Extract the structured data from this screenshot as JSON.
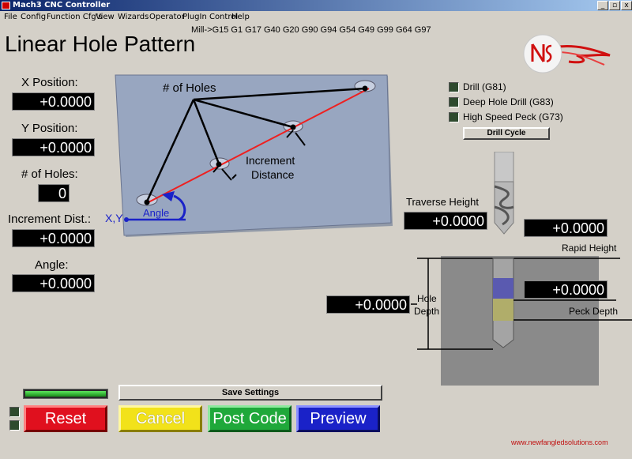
{
  "window": {
    "title": "Mach3 CNC Controller",
    "minimize": "_",
    "restore": "▫",
    "close": "x"
  },
  "menu": [
    "File",
    "Config",
    "Function Cfg's",
    "View",
    "Wizards",
    "Operator",
    "PlugIn Control",
    "Help"
  ],
  "gcode_line": "Mill->G15  G1 G17 G40 G20 G90 G94 G54 G49 G99 G64 G97",
  "page_title": "Linear Hole Pattern",
  "fields": {
    "x_position": {
      "label": "X Position:",
      "value": "+0.0000"
    },
    "y_position": {
      "label": "Y Position:",
      "value": "+0.0000"
    },
    "num_holes": {
      "label": "# of Holes:",
      "value": "0"
    },
    "increment": {
      "label": "Increment Dist.:",
      "value": "+0.0000"
    },
    "angle": {
      "label": "Angle:",
      "value": "+0.0000"
    }
  },
  "diagram": {
    "holes_label": "# of Holes",
    "increment_label_1": "Increment",
    "increment_label_2": "Distance",
    "angle_label": "Angle",
    "xy_label": "X,Y"
  },
  "cycles": {
    "drill": "Drill (G81)",
    "deep_drill": "Deep Hole Drill (G83)",
    "peck": "High Speed Peck (G73)",
    "button": "Drill Cycle"
  },
  "heights": {
    "traverse_label": "Traverse Height",
    "traverse_value": "+0.0000",
    "rapid_label": "Rapid Height",
    "rapid_value": "+0.0000",
    "hole_depth_label_1": "Hole",
    "hole_depth_label_2": "Depth",
    "hole_depth_value": "+0.0000",
    "peck_label": "Peck Depth",
    "peck_value": "+0.0000"
  },
  "buttons": {
    "save": "Save Settings",
    "reset": "Reset",
    "cancel": "Cancel",
    "post": "Post Code",
    "preview": "Preview"
  },
  "website": "www.newfangledsolutions.com",
  "colors": {
    "reset": "#e0101e",
    "cancel": "#f2e21a",
    "post": "#1fa83a",
    "preview": "#1a22c8",
    "red_line": "#ee2020",
    "angle_blue": "#1a22c8"
  }
}
